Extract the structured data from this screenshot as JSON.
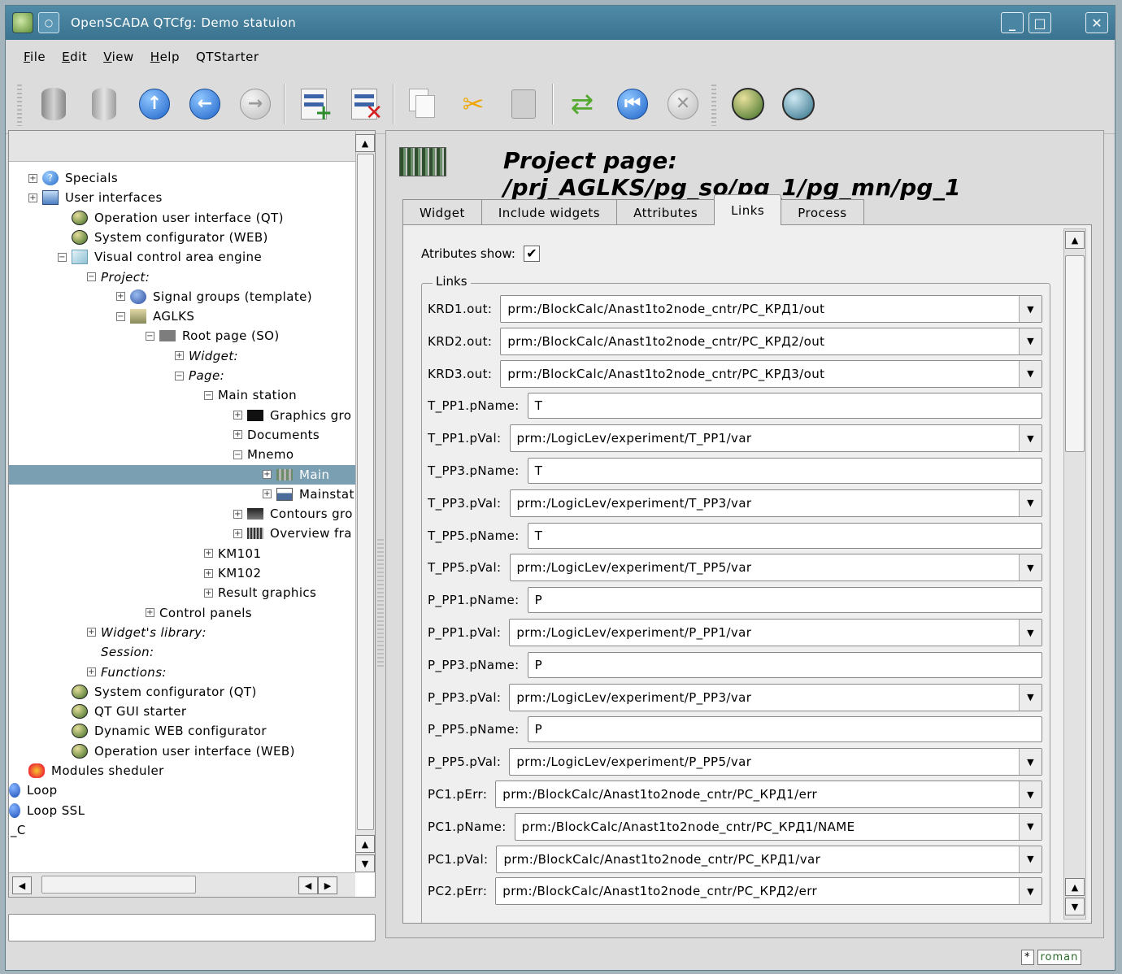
{
  "window": {
    "title": "OpenSCADA QTCfg: Demo statuion"
  },
  "menu": [
    {
      "label": "File",
      "key": "F",
      "rest": "ile"
    },
    {
      "label": "Edit",
      "key": "E",
      "rest": "dit"
    },
    {
      "label": "View",
      "key": "V",
      "rest": "iew"
    },
    {
      "label": "Help",
      "key": "H",
      "rest": "elp"
    },
    {
      "label": "QTStarter",
      "key": "",
      "rest": "QTStarter"
    }
  ],
  "toolbar": {
    "buttons": [
      "db-load-icon",
      "db-save-icon",
      "up-icon",
      "back-icon",
      "forward-icon",
      "add-item-icon",
      "delete-item-icon",
      "copy-icon",
      "cut-icon",
      "paste-icon",
      "refresh-icon",
      "start-icon",
      "stop-icon",
      "qt-gui-icon",
      "system-configurator-icon"
    ]
  },
  "tree": {
    "rows": [
      {
        "label": "Specials",
        "icon": "help-icon",
        "indent": 0,
        "exp": "+",
        "italic": false
      },
      {
        "label": "User interfaces",
        "icon": "monitor-icon",
        "indent": 0,
        "exp": "+",
        "italic": false
      },
      {
        "label": "Operation user interface (QT)",
        "icon": "app-icon",
        "indent": 1,
        "exp": "",
        "italic": false
      },
      {
        "label": "System configurator (WEB)",
        "icon": "app-icon",
        "indent": 1,
        "exp": "",
        "italic": false
      },
      {
        "label": "Visual control area engine",
        "icon": "cube-icon",
        "indent": 1,
        "exp": "-",
        "italic": false
      },
      {
        "label": "Project:",
        "icon": "",
        "indent": 2,
        "exp": "-",
        "italic": true
      },
      {
        "label": "Signal groups (template)",
        "icon": "signal-icon",
        "indent": 3,
        "exp": "+",
        "italic": false
      },
      {
        "label": "AGLKS",
        "icon": "aglks-icon",
        "indent": 3,
        "exp": "-",
        "italic": false
      },
      {
        "label": "Root page (SO)",
        "icon": "page-grey-icon",
        "indent": 4,
        "exp": "-",
        "italic": false
      },
      {
        "label": "Widget:",
        "icon": "",
        "indent": 5,
        "exp": "+",
        "italic": true
      },
      {
        "label": "Page:",
        "icon": "",
        "indent": 5,
        "exp": "-",
        "italic": true
      },
      {
        "label": "Main station",
        "icon": "",
        "indent": 6,
        "exp": "-",
        "italic": false
      },
      {
        "label": "Graphics gro",
        "icon": "page-black-icon",
        "indent": 7,
        "exp": "+",
        "italic": false
      },
      {
        "label": "Documents",
        "icon": "",
        "indent": 7,
        "exp": "+",
        "italic": false
      },
      {
        "label": "Mnemo",
        "icon": "",
        "indent": 7,
        "exp": "-",
        "italic": false
      },
      {
        "label": "Main",
        "icon": "mnemo-icon",
        "indent": 8,
        "exp": "+",
        "italic": false,
        "selected": true
      },
      {
        "label": "Mainstat",
        "icon": "picture-icon",
        "indent": 8,
        "exp": "+",
        "italic": false
      },
      {
        "label": "Contours gro",
        "icon": "page-dark-icon",
        "indent": 7,
        "exp": "+",
        "italic": false
      },
      {
        "label": "Overview fra",
        "icon": "page-stripe-icon",
        "indent": 7,
        "exp": "+",
        "italic": false
      },
      {
        "label": "KM101",
        "icon": "",
        "indent": 6,
        "exp": "+",
        "italic": false
      },
      {
        "label": "KM102",
        "icon": "",
        "indent": 6,
        "exp": "+",
        "italic": false
      },
      {
        "label": "Result graphics",
        "icon": "",
        "indent": 6,
        "exp": "+",
        "italic": false
      },
      {
        "label": "Control panels",
        "icon": "",
        "indent": 4,
        "exp": "+",
        "italic": false
      },
      {
        "label": "Widget's library:",
        "icon": "",
        "indent": 2,
        "exp": "+",
        "italic": true
      },
      {
        "label": "Session:",
        "icon": "",
        "indent": 2,
        "exp": "",
        "italic": true
      },
      {
        "label": "Functions:",
        "icon": "",
        "indent": 2,
        "exp": "+",
        "italic": true
      },
      {
        "label": "System configurator (QT)",
        "icon": "app-icon",
        "indent": 1,
        "exp": "",
        "italic": false
      },
      {
        "label": "QT GUI starter",
        "icon": "app-icon",
        "indent": 1,
        "exp": "",
        "italic": false
      },
      {
        "label": "Dynamic WEB configurator",
        "icon": "app-icon",
        "indent": 1,
        "exp": "",
        "italic": false
      },
      {
        "label": "Operation user interface (WEB)",
        "icon": "app-icon",
        "indent": 1,
        "exp": "",
        "italic": false
      },
      {
        "label": "Modules sheduler",
        "icon": "heart-icon",
        "indent": 0,
        "exp": "",
        "italic": false
      },
      {
        "label": "Loop",
        "icon": "blue-ball-icon",
        "indent": -1,
        "exp": "",
        "italic": false
      },
      {
        "label": "Loop SSL",
        "icon": "blue-ball-icon",
        "indent": -1,
        "exp": "",
        "italic": false
      },
      {
        "label": "_C",
        "icon": "",
        "indent": -2,
        "exp": "",
        "italic": false
      }
    ]
  },
  "page": {
    "title": "Project page: /prj_AGLKS/pg_so/pg_1/pg_mn/pg_1",
    "tabs": [
      "Widget",
      "Include widgets",
      "Attributes",
      "Links",
      "Process"
    ],
    "active_tab": 3,
    "attr_show_label": "Atributes show:",
    "attr_show_checked": "✔",
    "group_title": "Links",
    "links": [
      {
        "label": "KRD1.out:",
        "value": "prm:/BlockCalc/Anast1to2node_cntr/PC_КРД1/out",
        "type": "combo"
      },
      {
        "label": "KRD2.out:",
        "value": "prm:/BlockCalc/Anast1to2node_cntr/PC_КРД2/out",
        "type": "combo"
      },
      {
        "label": "KRD3.out:",
        "value": "prm:/BlockCalc/Anast1to2node_cntr/PC_КРД3/out",
        "type": "combo"
      },
      {
        "label": "T_PP1.pName:",
        "value": "T",
        "type": "text"
      },
      {
        "label": "T_PP1.pVal:",
        "value": "prm:/LogicLev/experiment/T_PP1/var",
        "type": "combo"
      },
      {
        "label": "T_PP3.pName:",
        "value": "T",
        "type": "text"
      },
      {
        "label": "T_PP3.pVal:",
        "value": "prm:/LogicLev/experiment/T_PP3/var",
        "type": "combo"
      },
      {
        "label": "T_PP5.pName:",
        "value": "T",
        "type": "text"
      },
      {
        "label": "T_PP5.pVal:",
        "value": "prm:/LogicLev/experiment/T_PP5/var",
        "type": "combo"
      },
      {
        "label": "P_PP1.pName:",
        "value": "P",
        "type": "text"
      },
      {
        "label": "P_PP1.pVal:",
        "value": "prm:/LogicLev/experiment/P_PP1/var",
        "type": "combo"
      },
      {
        "label": "P_PP3.pName:",
        "value": "P",
        "type": "text"
      },
      {
        "label": "P_PP3.pVal:",
        "value": "prm:/LogicLev/experiment/P_PP3/var",
        "type": "combo"
      },
      {
        "label": "P_PP5.pName:",
        "value": "P",
        "type": "text"
      },
      {
        "label": "P_PP5.pVal:",
        "value": "prm:/LogicLev/experiment/P_PP5/var",
        "type": "combo"
      },
      {
        "label": "PC1.pErr:",
        "value": "prm:/BlockCalc/Anast1to2node_cntr/PC_КРД1/err",
        "type": "combo"
      },
      {
        "label": "PC1.pName:",
        "value": "prm:/BlockCalc/Anast1to2node_cntr/PC_КРД1/NAME",
        "type": "combo"
      },
      {
        "label": "PC1.pVal:",
        "value": "prm:/BlockCalc/Anast1to2node_cntr/PC_КРД1/var",
        "type": "combo"
      },
      {
        "label": "PC2.pErr:",
        "value": "prm:/BlockCalc/Anast1to2node_cntr/PC_КРД2/err",
        "type": "combo"
      }
    ]
  },
  "status": {
    "user": "roman",
    "marker": "*"
  }
}
